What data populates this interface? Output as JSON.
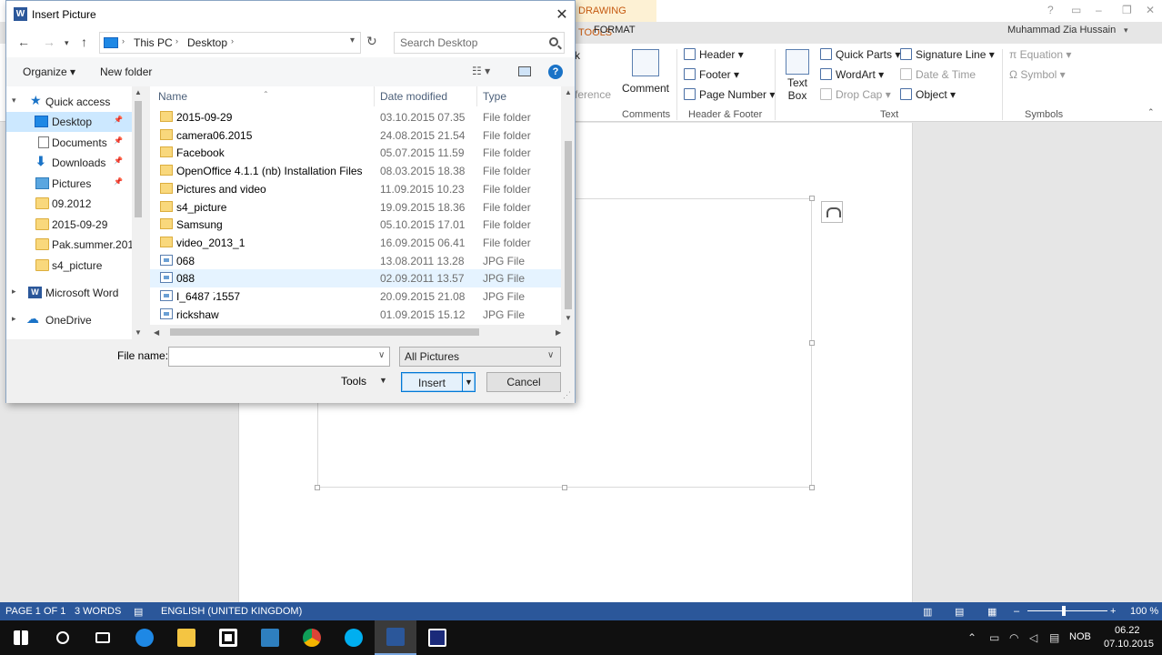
{
  "word": {
    "drawing_tools": "DRAWING TOOLS",
    "format_tab": "FORMAT",
    "user_name": "Muhammad Zia Hussain",
    "ribbon": {
      "comment_partial": "k",
      "reference_partial": "ference",
      "comment": "Comment",
      "comments_group": "Comments",
      "header": "Header",
      "footer": "Footer",
      "page_number": "Page Number",
      "header_footer_group": "Header & Footer",
      "text_box_1": "Text",
      "text_box_2": "Box",
      "quick_parts": "Quick Parts",
      "wordart": "WordArt",
      "drop_cap": "Drop Cap",
      "signature_line": "Signature Line",
      "date_time": "Date & Time",
      "object": "Object",
      "text_group": "Text",
      "equation": "Equation",
      "symbol": "Symbol",
      "symbols_group": "Symbols"
    },
    "status": {
      "page": "PAGE 1 OF 1",
      "words": "3 WORDS",
      "language": "ENGLISH (UNITED KINGDOM)",
      "zoom": "100 %",
      "zoom_level": 1.0
    }
  },
  "taskbar": {
    "lang": "NOB",
    "time": "06.22",
    "date": "07.10.2015",
    "icons": [
      "windows-start-icon",
      "search-icon",
      "task-view-icon",
      "edge-icon",
      "file-explorer-icon",
      "store-icon",
      "calculator-icon",
      "chrome-icon",
      "skype-icon",
      "word-icon",
      "screen-recorder-icon"
    ]
  },
  "dialog": {
    "title": "Insert Picture",
    "address": {
      "crumbs": [
        "This PC",
        "Desktop"
      ]
    },
    "search_placeholder": "Search Desktop",
    "organize": "Organize",
    "new_folder": "New folder",
    "nav": [
      {
        "label": "Quick access",
        "kind": "star",
        "expander": "▾",
        "pinned": false
      },
      {
        "label": "Desktop",
        "kind": "desktop",
        "pinned": true,
        "selected": true
      },
      {
        "label": "Documents",
        "kind": "docs",
        "pinned": true
      },
      {
        "label": "Downloads",
        "kind": "down",
        "pinned": true
      },
      {
        "label": "Pictures",
        "kind": "pics",
        "pinned": true
      },
      {
        "label": "09.2012",
        "kind": "folder"
      },
      {
        "label": "2015-09-29",
        "kind": "folder"
      },
      {
        "label": "Pak.summer.201",
        "kind": "folder"
      },
      {
        "label": "s4_picture",
        "kind": "folder"
      },
      {
        "label": "Microsoft Word",
        "kind": "word",
        "expander": "▸"
      },
      {
        "label": "OneDrive",
        "kind": "cloud",
        "expander": "▸"
      }
    ],
    "columns": {
      "name": "Name",
      "date": "Date modified",
      "type": "Type"
    },
    "files": [
      {
        "name": "2015-09-29",
        "date": "03.10.2015 07.35",
        "type": "File folder",
        "icon": "folder"
      },
      {
        "name": "camera06.2015",
        "date": "24.08.2015 21.54",
        "type": "File folder",
        "icon": "folder"
      },
      {
        "name": "Facebook",
        "date": "05.07.2015 11.59",
        "type": "File folder",
        "icon": "folder"
      },
      {
        "name": "OpenOffice 4.1.1 (nb) Installation Files",
        "date": "08.03.2015 18.38",
        "type": "File folder",
        "icon": "folder"
      },
      {
        "name": "Pictures and video",
        "date": "11.09.2015 10.23",
        "type": "File folder",
        "icon": "folder"
      },
      {
        "name": "s4_picture",
        "date": "19.09.2015 18.36",
        "type": "File folder",
        "icon": "folder"
      },
      {
        "name": "Samsung",
        "date": "05.10.2015 17.01",
        "type": "File folder",
        "icon": "folder"
      },
      {
        "name": "video_2013_1",
        "date": "16.09.2015 06.41",
        "type": "File folder",
        "icon": "folder"
      },
      {
        "name": "068",
        "date": "13.08.2011 13.28",
        "type": "JPG File",
        "icon": "jpg"
      },
      {
        "name": "088",
        "date": "02.09.2011 13.57",
        "type": "JPG File",
        "icon": "jpg",
        "hover": true
      },
      {
        "name": "I_648741557",
        "date": "20.09.2015 21.08",
        "type": "JPG File",
        "icon": "jpg"
      },
      {
        "name": "rickshaw",
        "date": "01.09.2015 15.12",
        "type": "JPG File",
        "icon": "jpg"
      }
    ],
    "file_name_label": "File name:",
    "file_name_value": "",
    "filter": "All Pictures",
    "tools": "Tools",
    "insert": "Insert",
    "cancel": "Cancel"
  }
}
